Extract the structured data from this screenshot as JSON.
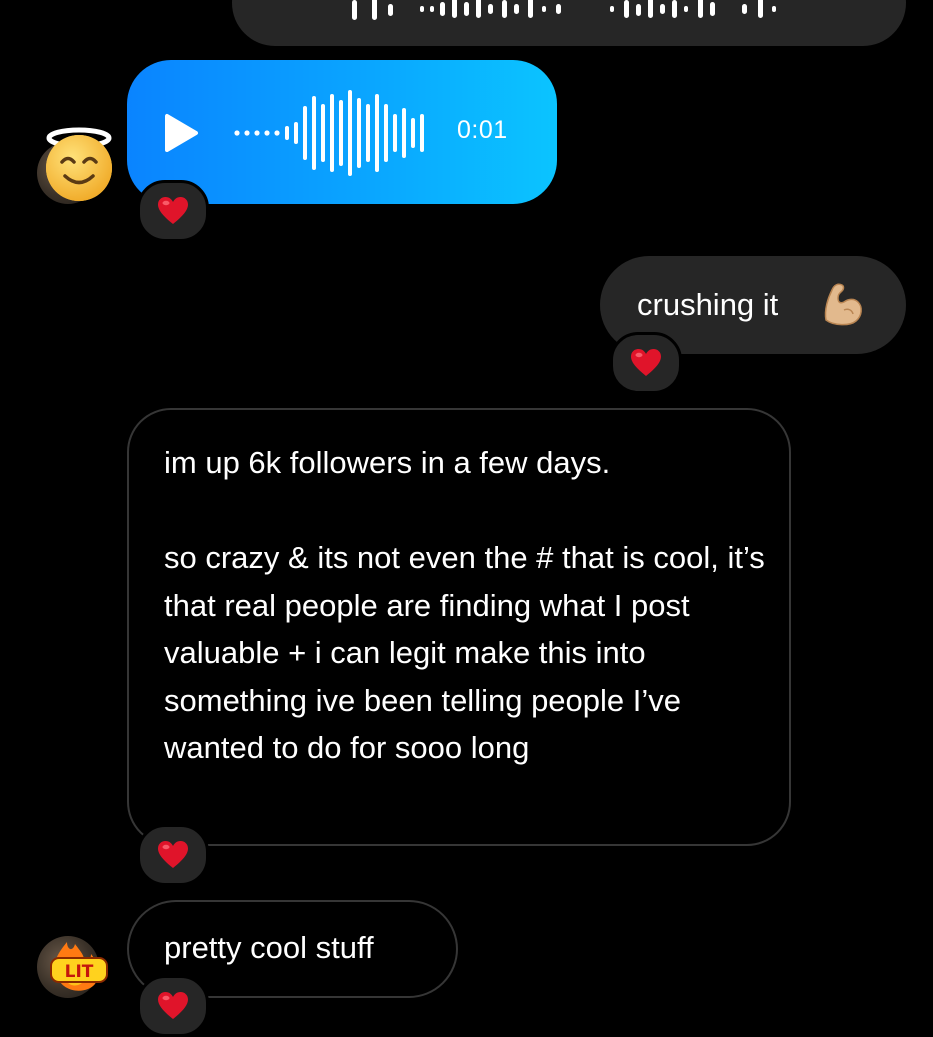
{
  "thread": {
    "voice_message": {
      "duration": "0:01"
    },
    "messages": [
      {
        "sender": "me",
        "text": "crushing it",
        "emoji": "flexed-biceps"
      },
      {
        "sender": "them",
        "text": "im up 6k followers in a few days.\n\nso crazy & its not even the # that is cool, it’s that real people are finding what I post valuable + i can legit make this into something ive been telling people I’ve wanted to do for sooo long"
      },
      {
        "sender": "them",
        "text": "pretty cool stuff"
      }
    ],
    "avatar_badges": [
      "smiling-face-with-halo-emoji",
      "lit-fire-sticker"
    ],
    "reaction": "red-heart-emoji"
  },
  "colors": {
    "background": "#000000",
    "sent_bubble": "#262626",
    "voice_gradient_start": "#0a84ff",
    "voice_gradient_end": "#0bc4ff",
    "received_border": "#363636",
    "heart": "#e0142a"
  }
}
